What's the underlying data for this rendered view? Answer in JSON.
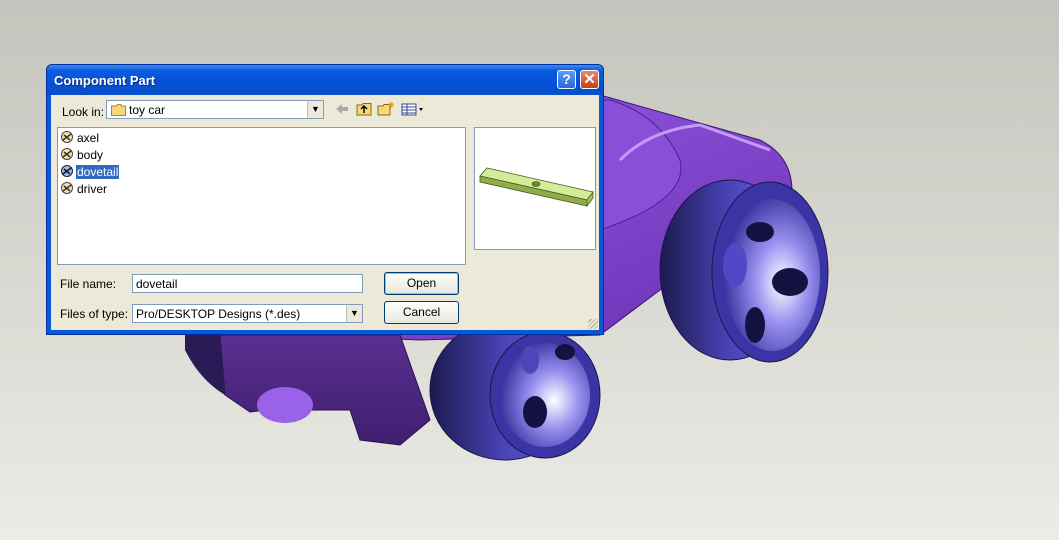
{
  "dialog": {
    "title": "Component Part",
    "help_glyph": "?",
    "close_glyph": "✕",
    "look_in_label": "Look in:",
    "look_in_value": "toy car",
    "files": [
      {
        "name": "axel",
        "selected": false
      },
      {
        "name": "body",
        "selected": false
      },
      {
        "name": "dovetail",
        "selected": true
      },
      {
        "name": "driver",
        "selected": false
      }
    ],
    "file_name_label": "File name:",
    "file_name_value": "dovetail",
    "files_of_type_label": "Files of type:",
    "files_of_type_value": "Pro/DESKTOP Designs (*.des)",
    "open_button": "Open",
    "cancel_button": "Cancel"
  },
  "toolbar_icons": [
    "back-arrow-icon",
    "up-folder-icon",
    "new-folder-icon",
    "view-menu-icon"
  ],
  "colors": {
    "title_bar": "#0451d6",
    "selection": "#316ac5",
    "car_body": "#7a3fc4",
    "wheel": "#5548c8",
    "preview_part": "#c6e28a"
  }
}
